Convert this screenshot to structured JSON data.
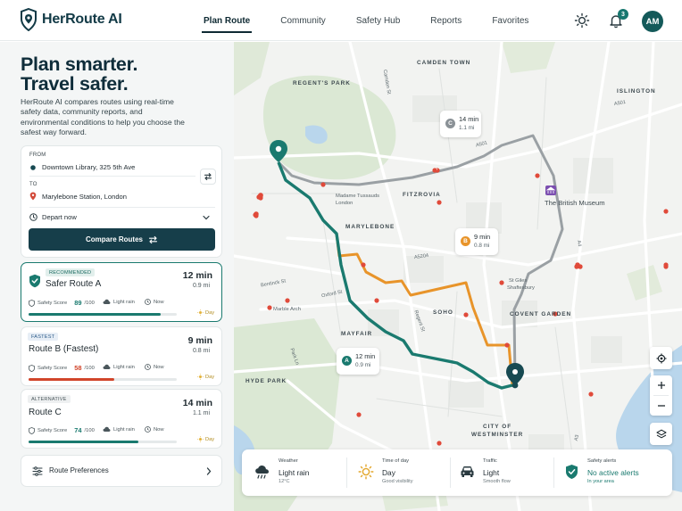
{
  "app": {
    "name": "HerRoute AI",
    "avatar_initials": "AM",
    "notification_count": "3"
  },
  "nav": {
    "items": [
      {
        "label": "Plan Route",
        "active": true
      },
      {
        "label": "Community",
        "active": false
      },
      {
        "label": "Safety Hub",
        "active": false
      },
      {
        "label": "Reports",
        "active": false
      },
      {
        "label": "Favorites",
        "active": false
      }
    ]
  },
  "hero": {
    "line1": "Plan smarter.",
    "line2": "Travel safer.",
    "description": "HerRoute AI compares routes using real-time safety data, community reports, and environmental conditions to help you choose the safest way forward."
  },
  "planner": {
    "from_label": "FROM",
    "from_value": "Downtown Library, 325 5th Ave",
    "to_label": "TO",
    "to_value": "Marylebone Station, London",
    "depart_value": "Depart now",
    "compare_button": "Compare Routes"
  },
  "routes": [
    {
      "tag": "RECOMMENDED",
      "name": "Safer Route A",
      "time": "12 min",
      "distance": "0.9 mi",
      "score_label": "Safety Score",
      "score": "89",
      "score_max": "/100",
      "score_fraction": 0.89,
      "weather": "Light rain",
      "timing": "Now",
      "period": "Day",
      "color": "#1a7a6f",
      "tag_bg": "#e2efec",
      "tag_fg": "#1a6a60"
    },
    {
      "tag": "FASTEST",
      "name": "Route B (Fastest)",
      "time": "9 min",
      "distance": "0.8 mi",
      "score_label": "Safety Score",
      "score": "58",
      "score_max": "/100",
      "score_fraction": 0.58,
      "weather": "Light rain",
      "timing": "Now",
      "period": "Day",
      "color": "#d1452a",
      "tag_bg": "#e7eef6",
      "tag_fg": "#2d5c8a"
    },
    {
      "tag": "ALTERNATIVE",
      "name": "Route C",
      "time": "14 min",
      "distance": "1.1 mi",
      "score_label": "Safety Score",
      "score": "74",
      "score_max": "/100",
      "score_fraction": 0.74,
      "weather": "Light rain",
      "timing": "Now",
      "period": "Day",
      "color": "#1a7a6f",
      "tag_bg": "#eef0f1",
      "tag_fg": "#4b575c"
    }
  ],
  "preferences": {
    "label": "Route Preferences"
  },
  "map": {
    "areas": [
      "CAMDEN TOWN",
      "REGENT'S PARK",
      "ISLINGTON",
      "FITZROVIA",
      "MARYLEBONE",
      "SOHO",
      "COVENT GARDEN",
      "MAYFAIR",
      "HYDE PARK",
      "CITY OF",
      "WESTMINSTER"
    ],
    "places": [
      "Madame Tussauds",
      "London",
      "The British Museum",
      "Marble Arch",
      "St Giles",
      "Shaftesbury"
    ],
    "streets": [
      "A501",
      "A501",
      "A5204",
      "Oxford St",
      "Bentinck St",
      "Regent St",
      "Park Ln",
      "Camden St",
      "A4",
      "A3"
    ],
    "bubbles": [
      {
        "letter": "C",
        "time": "14 min",
        "distance": "1.1 mi",
        "color": "#8a9196"
      },
      {
        "letter": "B",
        "time": "9 min",
        "distance": "0.8 mi",
        "color": "#e8942a"
      },
      {
        "letter": "A",
        "time": "12 min",
        "distance": "0.9 mi",
        "color": "#1a7a6f"
      }
    ],
    "route_colors": {
      "a": "#1a7a6f",
      "b": "#e8942a",
      "c": "#9aa0a4"
    }
  },
  "conditions": [
    {
      "title": "Weather",
      "value": "Light rain",
      "sub": "12°C"
    },
    {
      "title": "Time of day",
      "value": "Day",
      "sub": "Good visibility"
    },
    {
      "title": "Traffic",
      "value": "Light",
      "sub": "Smooth flow"
    },
    {
      "title": "Safety alerts",
      "value": "No active alerts",
      "sub": "In your area"
    }
  ]
}
